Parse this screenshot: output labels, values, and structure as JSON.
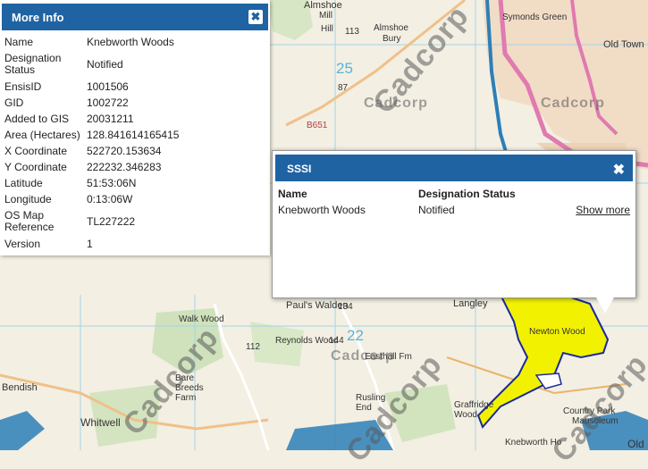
{
  "more_info": {
    "title": "More Info",
    "close_label": "✖",
    "rows": [
      {
        "key": "Name",
        "value": "Knebworth Woods"
      },
      {
        "key": "Designation Status",
        "value": "Notified"
      },
      {
        "key": "EnsisID",
        "value": "1001506"
      },
      {
        "key": "GID",
        "value": "1002722"
      },
      {
        "key": "Added to GIS",
        "value": "20031211"
      },
      {
        "key": "Area (Hectares)",
        "value": "128.841614165415"
      },
      {
        "key": "X Coordinate",
        "value": "522720.153634"
      },
      {
        "key": "Y Coordinate",
        "value": "222232.346283"
      },
      {
        "key": "Latitude",
        "value": "51:53:06N"
      },
      {
        "key": "Longitude",
        "value": "0:13:06W"
      },
      {
        "key": "OS Map Reference",
        "value": "TL227222"
      },
      {
        "key": "Version",
        "value": "1"
      }
    ]
  },
  "sssi": {
    "title": "SSSI",
    "close_label": "✖",
    "col_name": "Name",
    "col_status": "Designation Status",
    "row_name": "Knebworth Woods",
    "row_status": "Notified",
    "show_more": "Show more"
  },
  "map": {
    "watermark": "Cadcorp",
    "labels": {
      "almshoe_top": "Almshoe",
      "mill": "Mill",
      "hill": "Hill",
      "almshoe_bury_1": "Almshoe",
      "almshoe_bury_2": "Bury",
      "grid_25": "25",
      "b651": "B651",
      "n87": "87",
      "n113": "113",
      "symonds_green": "Symonds Green",
      "old_town": "Old Town",
      "walk_wood": "Walk Wood",
      "reynolds_wood": "Reynolds Wood",
      "easthall": "Easthall Fm",
      "n144": "144",
      "n112": "112",
      "grid_22": "22",
      "bendish": "Bendish",
      "bare_breeds": "Bare Breeds Farm",
      "whitwell": "Whitwell",
      "rusling_end": "Rusling End",
      "graffridge": "Graffridge Wood",
      "newton_wood": "Newton Wood",
      "langley": "Langley",
      "country_park": "Country Park",
      "mausoleum": "Mausoleum",
      "knebworth": "Knebworth Ho",
      "old": "Old",
      "pauls_walden": "Paul's Walden",
      "n134": "134"
    },
    "colors": {
      "land": "#f3efe3",
      "sssi_fill": "#f2f200",
      "sssi_outline": "#1a2a9a",
      "urban": "#f1dcc6",
      "road_primary": "#e07ab0",
      "grid": "#9bd4e8",
      "water": "#2c7fb8"
    }
  }
}
